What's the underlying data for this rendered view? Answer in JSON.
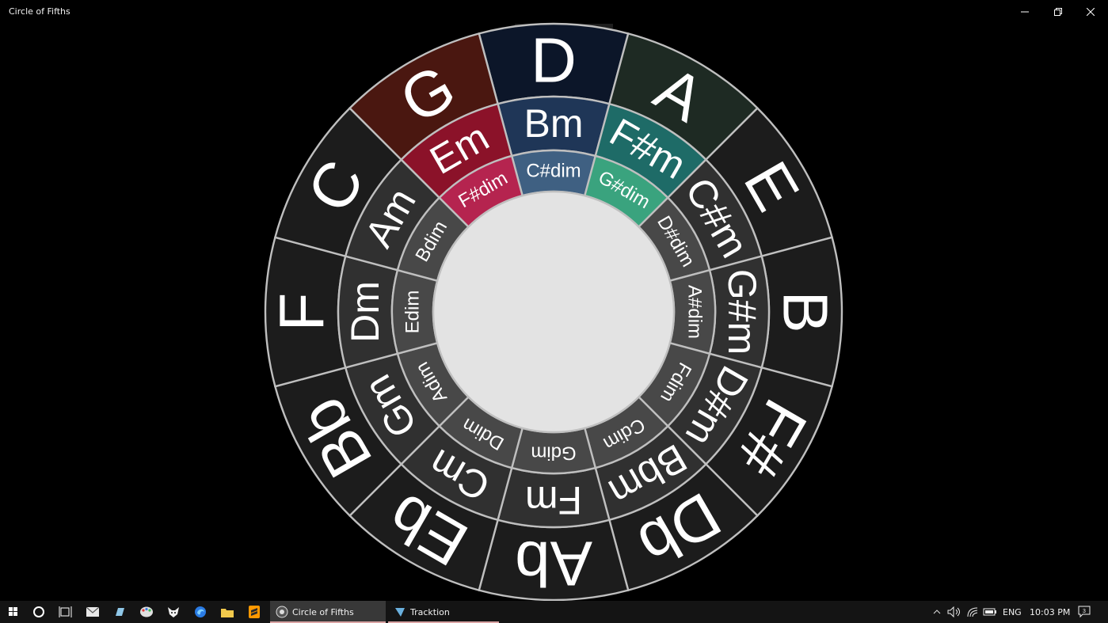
{
  "window": {
    "title": "Circle of Fifths"
  },
  "wheel": {
    "majors": [
      {
        "label": "D",
        "color": "#0c1629"
      },
      {
        "label": "A",
        "color": "#1e2a23"
      },
      {
        "label": "E",
        "color": "#1c1c1c"
      },
      {
        "label": "B",
        "color": "#1c1c1c"
      },
      {
        "label": "F#",
        "color": "#1c1c1c"
      },
      {
        "label": "Db",
        "color": "#1c1c1c"
      },
      {
        "label": "Ab",
        "color": "#1c1c1c"
      },
      {
        "label": "Eb",
        "color": "#1c1c1c"
      },
      {
        "label": "Bb",
        "color": "#1c1c1c"
      },
      {
        "label": "F",
        "color": "#1c1c1c"
      },
      {
        "label": "C",
        "color": "#1c1c1c"
      },
      {
        "label": "G",
        "color": "#4a1710"
      }
    ],
    "minors": [
      {
        "label": "Bm",
        "color": "#1f3657"
      },
      {
        "label": "F#m",
        "color": "#1e6b67"
      },
      {
        "label": "C#m",
        "color": "#303030"
      },
      {
        "label": "G#m",
        "color": "#303030"
      },
      {
        "label": "D#m",
        "color": "#303030"
      },
      {
        "label": "Bbm",
        "color": "#303030"
      },
      {
        "label": "Fm",
        "color": "#303030"
      },
      {
        "label": "Cm",
        "color": "#303030"
      },
      {
        "label": "Gm",
        "color": "#303030"
      },
      {
        "label": "Dm",
        "color": "#303030"
      },
      {
        "label": "Am",
        "color": "#303030"
      },
      {
        "label": "Em",
        "color": "#8b1229"
      }
    ],
    "diminished": [
      {
        "label": "C#dim",
        "color": "#3f6082"
      },
      {
        "label": "G#dim",
        "color": "#3aa37e"
      },
      {
        "label": "D#dim",
        "color": "#484848"
      },
      {
        "label": "A#dim",
        "color": "#484848"
      },
      {
        "label": "Fdim",
        "color": "#484848"
      },
      {
        "label": "Cdim",
        "color": "#484848"
      },
      {
        "label": "Gdim",
        "color": "#484848"
      },
      {
        "label": "Ddim",
        "color": "#484848"
      },
      {
        "label": "Adim",
        "color": "#484848"
      },
      {
        "label": "Edim",
        "color": "#484848"
      },
      {
        "label": "Bdim",
        "color": "#484848"
      },
      {
        "label": "F#dim",
        "color": "#b5244f"
      }
    ],
    "center_color": "#e3e3e3"
  },
  "taskbar": {
    "apps": [
      {
        "label": "Circle of Fifths"
      },
      {
        "label": "Tracktion"
      }
    ],
    "language": "ENG",
    "clock": "10:03 PM"
  },
  "colors": {
    "accent_underline": "#d9a3a3"
  }
}
